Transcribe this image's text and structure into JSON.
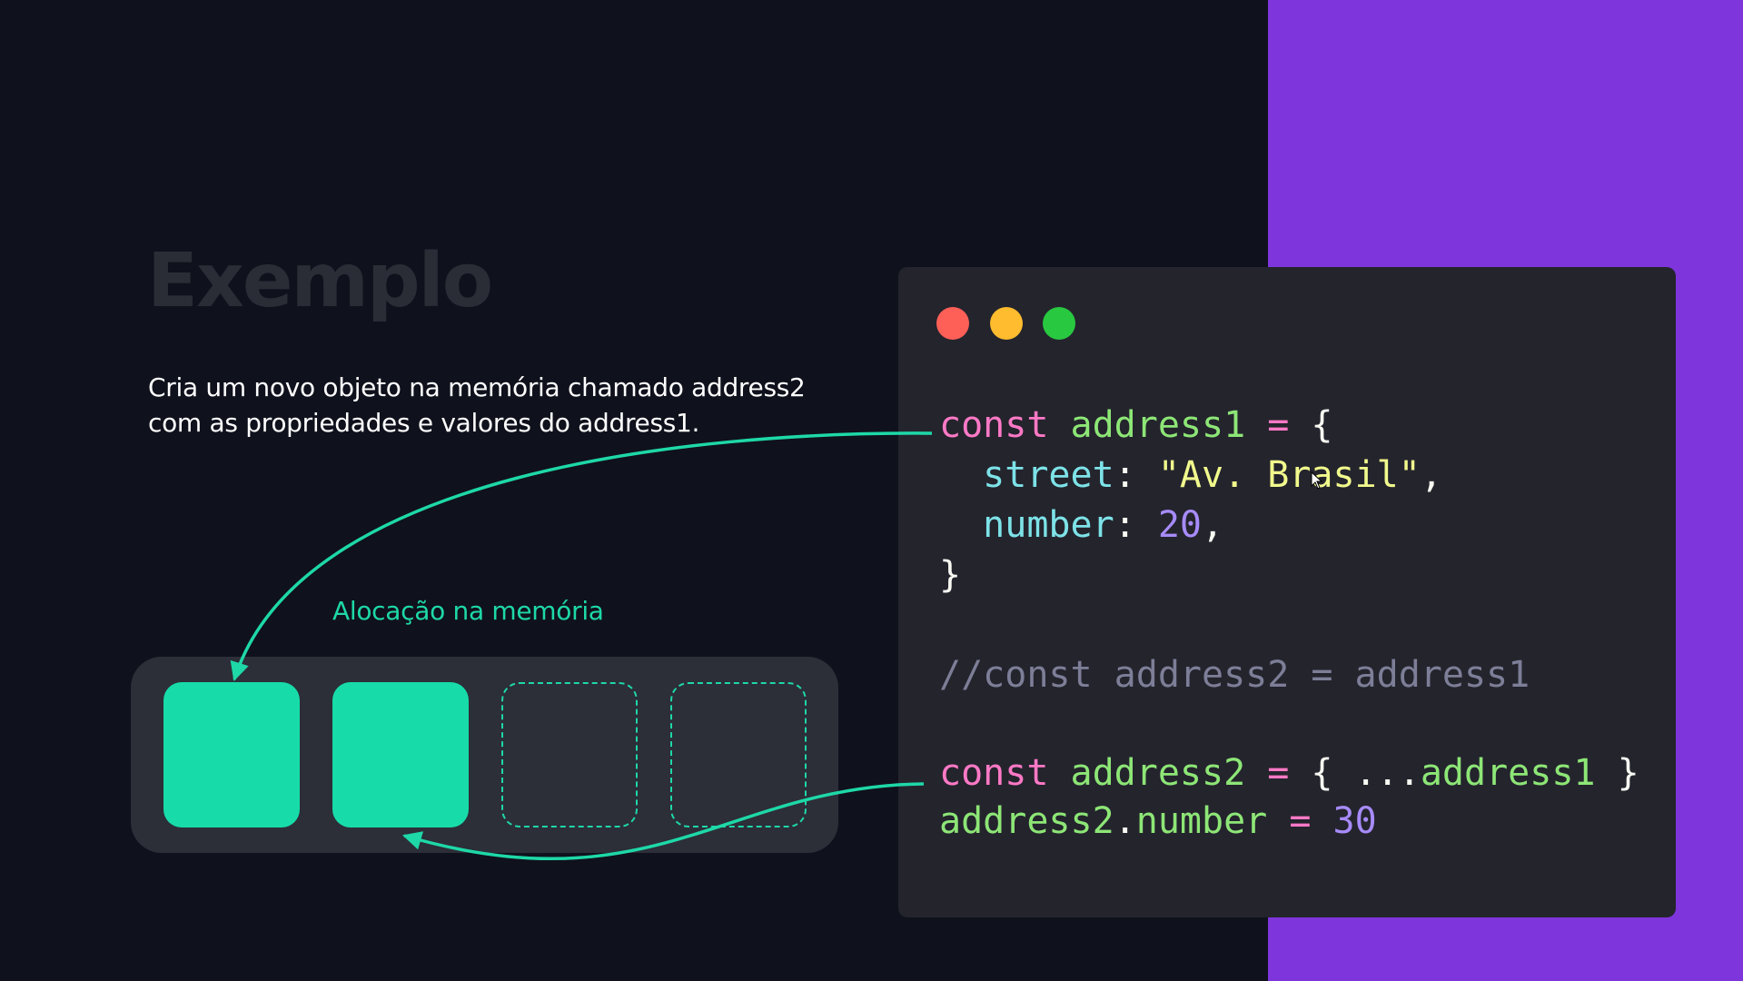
{
  "slide": {
    "title": "Exemplo",
    "description_lines": [
      "Cria um novo objeto na memória chamado address2",
      "com as propriedades e valores do address1."
    ],
    "memory_label": "Alocação na memória"
  },
  "memory_slots": [
    {
      "state": "filled"
    },
    {
      "state": "filled"
    },
    {
      "state": "empty"
    },
    {
      "state": "empty"
    }
  ],
  "code": {
    "window_controls": [
      "close-dot",
      "minimize-dot",
      "maximize-dot"
    ],
    "lines": [
      [
        {
          "t": "const ",
          "c": "kw"
        },
        {
          "t": "address1 ",
          "c": "var"
        },
        {
          "t": "= ",
          "c": "op"
        },
        {
          "t": "{",
          "c": "punc"
        }
      ],
      [
        {
          "t": "  street",
          "c": "prop"
        },
        {
          "t": ": ",
          "c": "punc"
        },
        {
          "t": "\"Av. Brasil\"",
          "c": "str"
        },
        {
          "t": ",",
          "c": "punc"
        }
      ],
      [
        {
          "t": "  number",
          "c": "prop"
        },
        {
          "t": ": ",
          "c": "punc"
        },
        {
          "t": "20",
          "c": "num"
        },
        {
          "t": ",",
          "c": "punc"
        }
      ],
      [
        {
          "t": "}",
          "c": "punc"
        }
      ],
      [
        {
          "t": "//const address2 = address1",
          "c": "cmt"
        }
      ],
      [
        {
          "t": "const ",
          "c": "kw"
        },
        {
          "t": "address2 ",
          "c": "var"
        },
        {
          "t": "= ",
          "c": "op"
        },
        {
          "t": "{ ...",
          "c": "punc"
        },
        {
          "t": "address1",
          "c": "var"
        },
        {
          "t": " }",
          "c": "punc"
        }
      ],
      [
        {
          "t": "address2",
          "c": "var"
        },
        {
          "t": ".",
          "c": "punc"
        },
        {
          "t": "number",
          "c": "var"
        },
        {
          "t": " = ",
          "c": "op"
        },
        {
          "t": "30",
          "c": "num"
        }
      ]
    ]
  },
  "colors": {
    "background": "#0f111c",
    "accent_panel": "#7f35dc",
    "accent_teal": "#1ed8a8",
    "code_background": "#24242d"
  }
}
